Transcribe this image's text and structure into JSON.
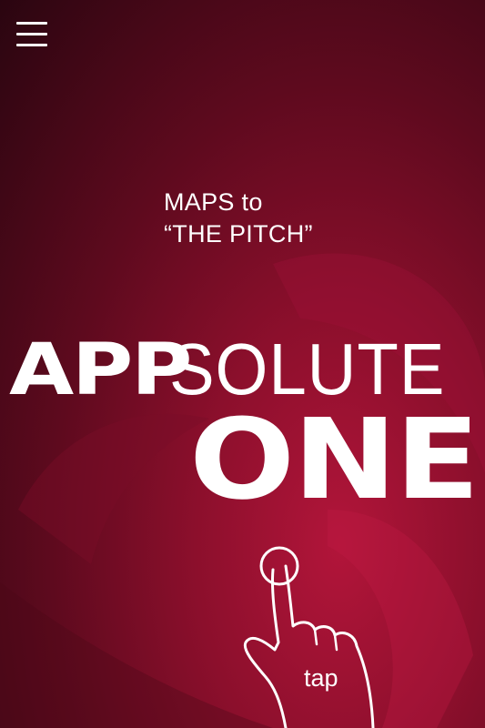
{
  "menu": {
    "icon": "hamburger-menu-icon"
  },
  "subtitle": {
    "line1": "MAPS to",
    "line2": "“THE PITCH”"
  },
  "logo": {
    "part1": "APP",
    "part2": "SOLUTE",
    "part3": "ONE"
  },
  "tap": {
    "label": "tap",
    "icon": "tap-hand-icon"
  },
  "colors": {
    "background_dark": "#2a0510",
    "background_mid": "#8c0f2c",
    "background_light": "#b2153a",
    "foreground": "#ffffff"
  }
}
